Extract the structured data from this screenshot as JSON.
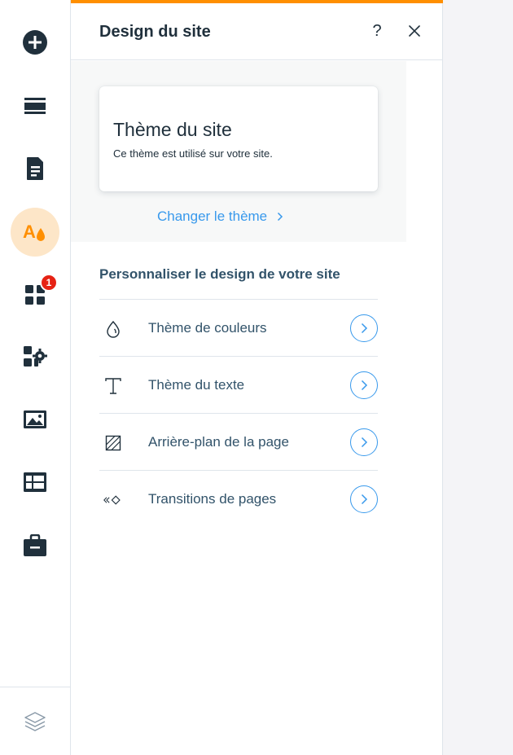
{
  "rail": {
    "items": [
      {
        "icon": "add-icon"
      },
      {
        "icon": "menus-icon"
      },
      {
        "icon": "pages-icon"
      },
      {
        "icon": "theme-icon",
        "active": true
      },
      {
        "icon": "apps-icon",
        "badge": "1"
      },
      {
        "icon": "business-solutions-icon"
      },
      {
        "icon": "media-icon"
      },
      {
        "icon": "cms-icon"
      },
      {
        "icon": "portfolio-icon"
      }
    ],
    "bottom_icon": "layers-icon"
  },
  "panel": {
    "title": "Design du site",
    "help_label": "?",
    "theme_card": {
      "title": "Thème du site",
      "description": "Ce thème est utilisé sur votre site."
    },
    "change_theme_label": "Changer le thème",
    "section_heading": "Personnaliser le design de votre site",
    "items": [
      {
        "label": "Thème de couleurs",
        "icon": "color-drop-icon"
      },
      {
        "label": "Thème du texte",
        "icon": "text-icon"
      },
      {
        "label": "Arrière-plan de la page",
        "icon": "background-icon"
      },
      {
        "label": "Transitions de pages",
        "icon": "transitions-icon"
      }
    ]
  },
  "colors": {
    "accent": "#ff8f00",
    "link": "#3899ec",
    "badge": "#e62214",
    "text": "#20303c"
  }
}
